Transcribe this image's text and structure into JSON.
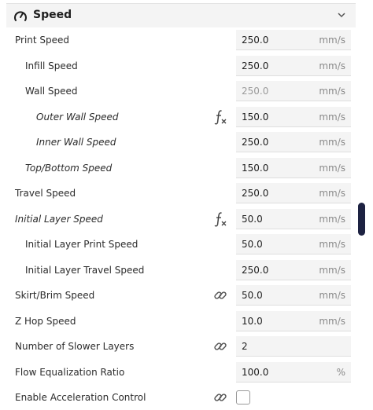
{
  "section": {
    "title": "Speed",
    "icon": "speedometer-icon",
    "toggle_icon": "chevron-down-icon"
  },
  "rows": [
    {
      "label": "Print Speed",
      "value": "250.0",
      "unit": "mm/s"
    },
    {
      "label": "Infill Speed",
      "value": "250.0",
      "unit": "mm/s"
    },
    {
      "label": "Wall Speed",
      "value": "250.0",
      "unit": "mm/s"
    },
    {
      "label": "Outer Wall Speed",
      "value": "150.0",
      "unit": "mm/s"
    },
    {
      "label": "Inner Wall Speed",
      "value": "250.0",
      "unit": "mm/s"
    },
    {
      "label": "Top/Bottom Speed",
      "value": "150.0",
      "unit": "mm/s"
    },
    {
      "label": "Travel Speed",
      "value": "250.0",
      "unit": "mm/s"
    },
    {
      "label": "Initial Layer Speed",
      "value": "50.0",
      "unit": "mm/s"
    },
    {
      "label": "Initial Layer Print Speed",
      "value": "50.0",
      "unit": "mm/s"
    },
    {
      "label": "Initial Layer Travel Speed",
      "value": "250.0",
      "unit": "mm/s"
    },
    {
      "label": "Skirt/Brim Speed",
      "value": "50.0",
      "unit": "mm/s"
    },
    {
      "label": "Z Hop Speed",
      "value": "10.0",
      "unit": "mm/s"
    },
    {
      "label": "Number of Slower Layers",
      "value": "2",
      "unit": ""
    },
    {
      "label": "Flow Equalization Ratio",
      "value": "100.0",
      "unit": "%"
    },
    {
      "label": "Enable Acceleration Control",
      "checked": false
    }
  ],
  "colors": {
    "scrollbar": "#1d2242",
    "field_background": "#f4f4f4",
    "disabled_text": "#9a9a9a"
  }
}
